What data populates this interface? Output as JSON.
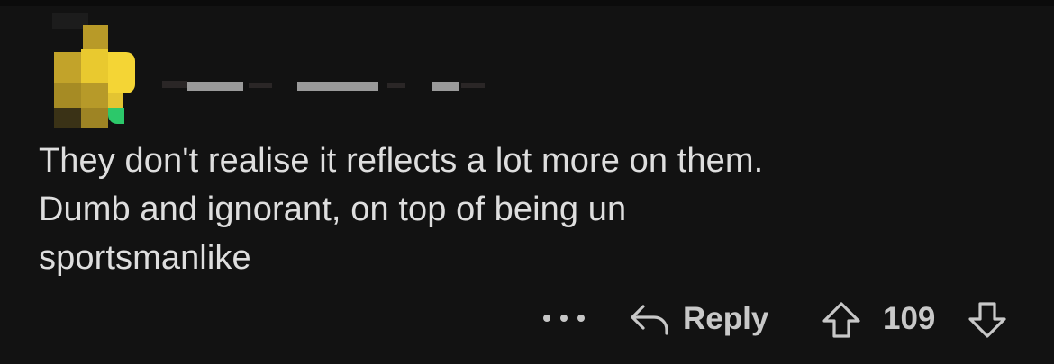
{
  "comment": {
    "author_redacted": true,
    "body_lines": [
      "They don't realise it reflects a lot more on them.",
      "Dumb and ignorant, on top of being un",
      "sportsmanlike"
    ]
  },
  "actions": {
    "more_icon": "ellipsis-icon",
    "reply_label": "Reply",
    "reply_icon": "reply-arrow-icon",
    "upvote_icon": "upvote-arrow-icon",
    "score": "109",
    "downvote_icon": "downvote-arrow-icon"
  },
  "colors": {
    "background": "#121212",
    "text": "#dedede",
    "muted": "#c8c8c8",
    "avatar_yellow": "#f2d234",
    "avatar_green": "#2cc86a"
  }
}
